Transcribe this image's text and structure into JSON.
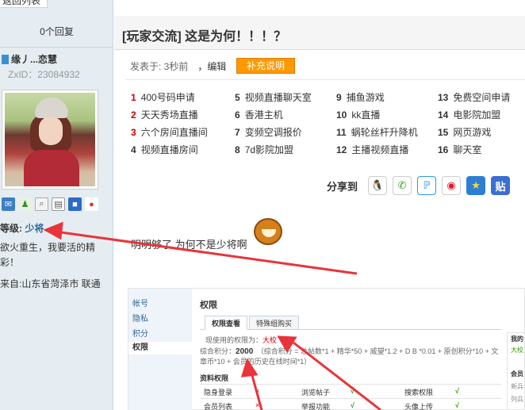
{
  "left": {
    "back_button": "返回列表",
    "reply_count": "0个回复",
    "user_name": "缘丿...恋慧",
    "zxid": "ZxID：23084932",
    "level_label": "等级:",
    "level_value": "少将",
    "motto": "欲火重生，我要活的精彩！",
    "from": "来自:山东省菏泽市 联通",
    "icons": [
      "mail-icon",
      "add-friend-icon",
      "search-profile-icon",
      "profile-card-icon",
      "group-icon",
      "qq-icon"
    ]
  },
  "thread": {
    "title": "[玩家交流] 这是为何！！！？",
    "meta": "发表于: 3秒前",
    "edit": "，编辑",
    "supplement_button": "补充说明",
    "links": [
      {
        "num": "1",
        "text": "400号码申请"
      },
      {
        "num": "2",
        "text": "天天秀场直播"
      },
      {
        "num": "3",
        "text": "六个房间直播间"
      },
      {
        "num": "4",
        "text": "视频直播房间"
      },
      {
        "num": "5",
        "text": "视频直播聊天室"
      },
      {
        "num": "6",
        "text": "香港主机"
      },
      {
        "num": "7",
        "text": "变频空调报价"
      },
      {
        "num": "8",
        "text": "7d影院加盟"
      },
      {
        "num": "9",
        "text": "捕鱼游戏"
      },
      {
        "num": "10",
        "text": "kk直播"
      },
      {
        "num": "11",
        "text": "蜗轮丝杆升降机"
      },
      {
        "num": "12",
        "text": "主播视频直播"
      },
      {
        "num": "13",
        "text": "免费空间申请"
      },
      {
        "num": "14",
        "text": "电影院加盟"
      },
      {
        "num": "15",
        "text": "网页游戏"
      },
      {
        "num": "16",
        "text": "聊天室"
      }
    ],
    "share_label": "分享到",
    "share_buttons": [
      "qq-share-icon",
      "wechat-share-icon",
      "tencent-weibo-icon",
      "sina-weibo-icon",
      "qzone-star-icon",
      "tieba-icon"
    ],
    "tieba_glyph": "贴",
    "body_text": "明明够了 为何不是少将啊"
  },
  "embed": {
    "nav": [
      "帐号",
      "隐私",
      "积分",
      "权限"
    ],
    "title": "权限",
    "tabs": [
      "权限查看",
      "特殊组购买"
    ],
    "perm_label": "现使用的权限为：",
    "perm_value": "大校",
    "score_label": "综合积分：",
    "score_value": "2000",
    "score_formula": "（综合积分 = 总帖数*1 + 精华*50 + 威望*1.2 + D B *0.01 + 原创积分*10 + 文章币*10 + 会员的历史在线时间*1）",
    "section": "资料权限",
    "rows": [
      [
        "隐身登录",
        "×",
        "浏览帖子",
        "√",
        "搜索权限",
        "√"
      ],
      [
        "会员列表",
        "×",
        "举报功能",
        "√",
        "头像上传",
        "√"
      ]
    ],
    "side": [
      "我的",
      "大校",
      "会员",
      "新兵",
      "列兵"
    ]
  },
  "colors": {
    "accent": "#ff9900",
    "link_number": "#cc0000",
    "arrow": "#e8343a",
    "sidebar_bg": "#e5edf2"
  }
}
